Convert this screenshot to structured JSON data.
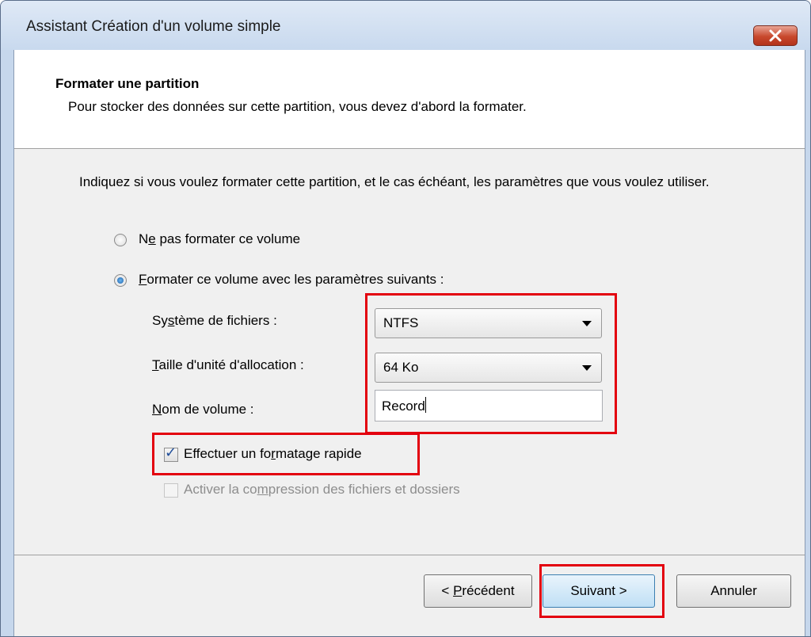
{
  "window": {
    "title": "Assistant Création d'un volume simple"
  },
  "header": {
    "title": "Formater une partition",
    "subtitle": "Pour stocker des données sur cette partition, vous devez d'abord la formater."
  },
  "intro": "Indiquez si vous voulez formater cette partition, et le cas échéant, les paramètres que vous voulez utiliser.",
  "options": {
    "no_format": {
      "label_pre": "N",
      "label_ul": "e",
      "label_post": " pas formater ce volume",
      "checked": false
    },
    "format": {
      "label_pre": "",
      "label_ul": "F",
      "label_post": "ormater ce volume avec les paramètres suivants :",
      "checked": true
    }
  },
  "settings": {
    "filesystem": {
      "label_pre": "Sy",
      "label_ul": "s",
      "label_post": "tème de fichiers :",
      "value": "NTFS"
    },
    "allocation": {
      "label_pre": "",
      "label_ul": "T",
      "label_post": "aille d'unité d'allocation :",
      "value": "64 Ko"
    },
    "volume_name": {
      "label_pre": "",
      "label_ul": "N",
      "label_post": "om de volume :",
      "value": "Record"
    }
  },
  "checkboxes": {
    "quick_format": {
      "label_pre": "Effectuer un fo",
      "label_ul": "r",
      "label_post": "matage rapide",
      "checked": true
    },
    "compression": {
      "label_pre": "Activer la co",
      "label_ul": "m",
      "label_post": "pression des fichiers et dossiers",
      "checked": false,
      "disabled": true
    }
  },
  "buttons": {
    "back": {
      "label_pre": "< ",
      "label_ul": "P",
      "label_post": "récédent"
    },
    "next": "Suivant >",
    "cancel": "Annuler"
  },
  "colors": {
    "highlight": "#e3000f",
    "title_bar": "#c6d7ec",
    "close_button": "#c8482d"
  }
}
